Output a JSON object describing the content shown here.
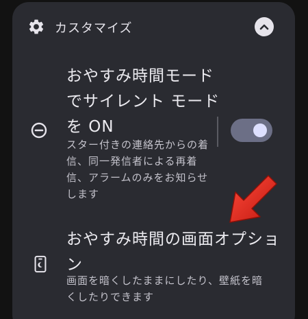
{
  "section": {
    "title": "カスタマイズ",
    "gear_icon": "gear-icon",
    "collapse_icon": "chevron-up-icon"
  },
  "dnd_setting": {
    "icon": "do-not-disturb-icon",
    "title_lines": [
      "おやすみ時間モード",
      "でサイレント モード",
      "を ON"
    ],
    "description_lines": [
      "スター付きの連絡先からの着",
      "信、同一発信者による再着",
      "信、アラームのみをお知らせ",
      "します"
    ],
    "toggle_state": "on"
  },
  "screen_options": {
    "icon": "phone-bedtime-icon",
    "title_lines": [
      "おやすみ時間の画面オプショ",
      "ン"
    ],
    "description_lines": [
      "画面を暗くしたままにしたり、壁紙を暗",
      "くしたりできます"
    ]
  },
  "colors": {
    "background": "#121212",
    "card": "#2a2b31",
    "text_primary": "#ecebf0",
    "text_secondary": "#c4c3cc",
    "toggle_track": "#6c6f86",
    "toggle_knob": "#dee0ff",
    "annotation_arrow": "#e8261d"
  },
  "annotation": {
    "icon": "red-arrow-annotation"
  }
}
